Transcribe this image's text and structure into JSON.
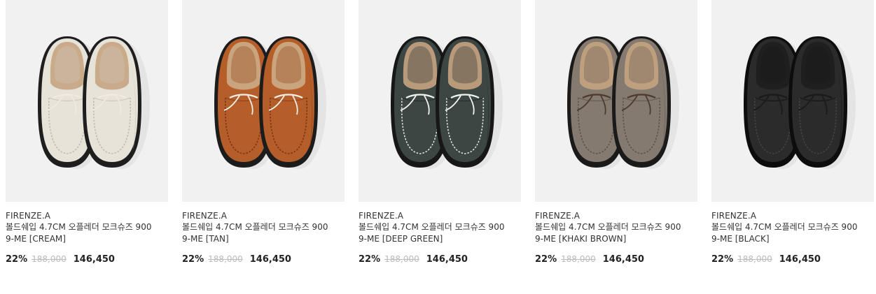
{
  "products": [
    {
      "brand": "FIRENZE.A",
      "name": "볼드쉐입 4.7CM 오플레더 모크슈즈 9009-ME [CREAM]",
      "discount": "22%",
      "original_price": "188,000",
      "sale_price": "146,450",
      "color": {
        "upper": "#e7e3d9",
        "shade": "#cfc9bb",
        "inner": "#c9aa8a",
        "sole": "#1e1e1e",
        "stitch": "#c2bcae",
        "lace": "#efebe2"
      }
    },
    {
      "brand": "FIRENZE.A",
      "name": "볼드쉐입 4.7CM 오플레더 모크슈즈 9009-ME [TAN]",
      "discount": "22%",
      "original_price": "188,000",
      "sale_price": "146,450",
      "color": {
        "upper": "#b65e2a",
        "shade": "#8e441b",
        "inner": "#c9a47c",
        "sole": "#1c1c1c",
        "stitch": "#7a3612",
        "lace": "#f2efe8"
      }
    },
    {
      "brand": "FIRENZE.A",
      "name": "볼드쉐입 4.7CM 오플레더 모크슈즈 9009-ME [DEEP GREEN]",
      "discount": "22%",
      "original_price": "188,000",
      "sale_price": "146,450",
      "color": {
        "upper": "#3c4643",
        "shade": "#283030",
        "inner": "#b99a7a",
        "sole": "#171717",
        "stitch": "#dcdcd8",
        "lace": "#f3f3f0"
      }
    },
    {
      "brand": "FIRENZE.A",
      "name": "볼드쉐입 4.7CM 오플레더 모크슈즈 9009-ME [KHAKI BROWN]",
      "discount": "22%",
      "original_price": "188,000",
      "sale_price": "146,450",
      "color": {
        "upper": "#857a70",
        "shade": "#665c53",
        "inner": "#bea07f",
        "sole": "#1a1a1a",
        "stitch": "#5d534b",
        "lace": "#4e3a2c"
      }
    },
    {
      "brand": "FIRENZE.A",
      "name": "볼드쉐입 4.7CM 오플레더 모크슈즈 9009-ME [BLACK]",
      "discount": "22%",
      "original_price": "188,000",
      "sale_price": "146,450",
      "color": {
        "upper": "#2b2b2b",
        "shade": "#161616",
        "inner": "#1f1f1f",
        "sole": "#0d0d0d",
        "stitch": "#444444",
        "lace": "#1a1a1a"
      }
    }
  ]
}
